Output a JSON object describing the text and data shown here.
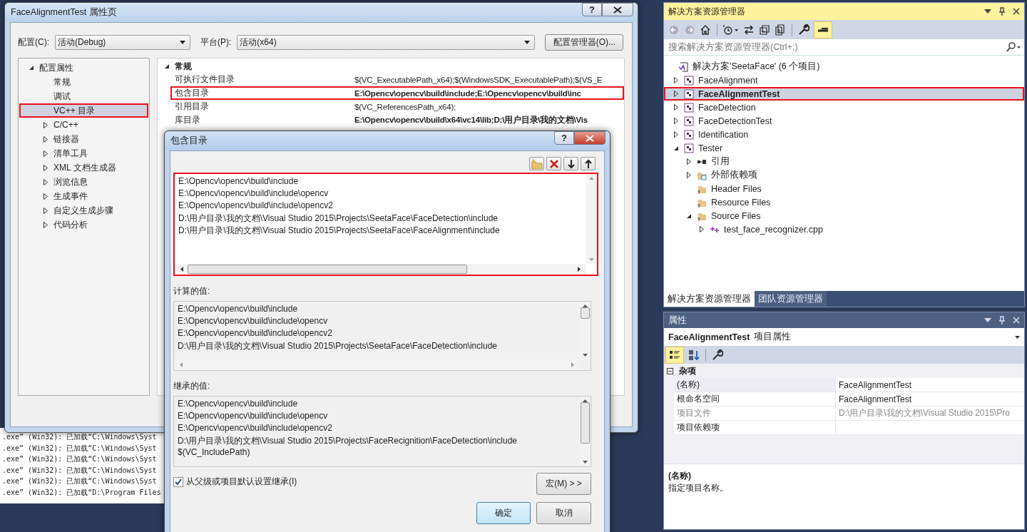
{
  "property_window": {
    "title": "FaceAlignmentTest 属性页",
    "help": "?",
    "configuration": {
      "label": "配置(C):",
      "value": "活动(Debug)"
    },
    "platform": {
      "label": "平台(P):",
      "value": "活动(x64)"
    },
    "config_manager_button": "配置管理器(O)...",
    "tree": [
      {
        "label": "配置属性",
        "expanded": true,
        "selected": false,
        "highlighted": false,
        "children": [
          {
            "label": "常规",
            "selected": false,
            "highlighted": false
          },
          {
            "label": "调试",
            "selected": false,
            "highlighted": false
          },
          {
            "label": "VC++ 目录",
            "selected": true,
            "highlighted": true
          },
          {
            "label": "C/C++",
            "selected": false,
            "highlighted": false,
            "expanded": false
          },
          {
            "label": "链接器",
            "selected": false,
            "highlighted": false,
            "expanded": false
          },
          {
            "label": "清单工具",
            "selected": false,
            "highlighted": false,
            "expanded": false
          },
          {
            "label": "XML 文档生成器",
            "selected": false,
            "highlighted": false,
            "expanded": false
          },
          {
            "label": "浏览信息",
            "selected": false,
            "highlighted": false,
            "expanded": false
          },
          {
            "label": "生成事件",
            "selected": false,
            "highlighted": false,
            "expanded": false
          },
          {
            "label": "自定义生成步骤",
            "selected": false,
            "highlighted": false,
            "expanded": false
          },
          {
            "label": "代码分析",
            "selected": false,
            "highlighted": false,
            "expanded": false
          }
        ]
      }
    ],
    "grid": {
      "category": "常规",
      "expanded": true,
      "rows": [
        {
          "name": "可执行文件目录",
          "value": "$(VC_ExecutablePath_x64);$(WindowsSDK_ExecutablePath);$(VS_E",
          "bold": false,
          "highlighted": false
        },
        {
          "name": "包含目录",
          "value": "E:\\Opencv\\opencv\\build\\include;E:\\Opencv\\opencv\\build\\inc",
          "bold": true,
          "highlighted": true
        },
        {
          "name": "引用目录",
          "value": "$(VC_ReferencesPath_x64);",
          "bold": false,
          "highlighted": false
        },
        {
          "name": "库目录",
          "value": "E:\\Opencv\\opencv\\build\\x64\\vc14\\lib;D:\\用户目录\\我的文档\\Vis",
          "bold": true,
          "highlighted": false
        }
      ]
    }
  },
  "include_dialog": {
    "title": "包含目录",
    "help": "?",
    "list_highlighted": true,
    "entries": [
      "E:\\Opencv\\opencv\\build\\include",
      "E:\\Opencv\\opencv\\build\\include\\opencv",
      "E:\\Opencv\\opencv\\build\\include\\opencv2",
      "D:\\用户目录\\我的文档\\Visual Studio 2015\\Projects\\SeetaFace\\FaceDetection\\include",
      "D:\\用户目录\\我的文档\\Visual Studio 2015\\Projects\\SeetaFace\\FaceAlignment\\include"
    ],
    "computed_label": "计算的值:",
    "computed": [
      "E:\\Opencv\\opencv\\build\\include",
      "E:\\Opencv\\opencv\\build\\include\\opencv",
      "E:\\Opencv\\opencv\\build\\include\\opencv2",
      "D:\\用户目录\\我的文档\\Visual Studio 2015\\Projects\\SeetaFace\\FaceDetection\\include"
    ],
    "inherited_label": "继承的值:",
    "inherited": [
      "E:\\Opencv\\opencv\\build\\include",
      "E:\\Opencv\\opencv\\build\\include\\opencv",
      "E:\\Opencv\\opencv\\build\\include\\opencv2",
      "D:\\用户目录\\我的文档\\Visual Studio 2015\\Projects\\FaceRecignition\\FaceDetection\\include",
      "$(VC_IncludePath)"
    ],
    "inherit_checkbox": {
      "label": "从父级或项目默认设置继承(I)",
      "checked": true
    },
    "macros_button": "宏(M) > >",
    "ok_button": "确定",
    "cancel_button": "取消"
  },
  "output_lines": [
    ".exe” (Win32): 已加载“C:\\Windows\\Syst",
    ".exe” (Win32): 已加载“C:\\Windows\\Syst",
    ".exe” (Win32): 已加载“C:\\Windows\\Syst",
    ".exe” (Win32): 已加载“C:\\Windows\\Syst",
    ".exe” (Win32): 已加载“C:\\Windows\\Syst",
    ".exe” (Win32): 已加载“D:\\Program Files"
  ],
  "solution_explorer": {
    "title": "解决方案资源管理器",
    "preview_on": true,
    "search_placeholder": "搜索解决方案资源管理器(Ctrl+;)",
    "tree": [
      {
        "kind": "solution",
        "label": "解决方案'SeetaFace' (6 个项目)",
        "selected": false,
        "highlighted": false,
        "children": [
          {
            "kind": "project",
            "label": "FaceAlignment",
            "expanded": false,
            "selected": false,
            "highlighted": false
          },
          {
            "kind": "project",
            "label": "FaceAlignmentTest",
            "expanded": false,
            "selected": true,
            "highlighted": true
          },
          {
            "kind": "project",
            "label": "FaceDetection",
            "expanded": false,
            "selected": false,
            "highlighted": false
          },
          {
            "kind": "project",
            "label": "FaceDetectionTest",
            "expanded": false,
            "selected": false,
            "highlighted": false
          },
          {
            "kind": "project",
            "label": "Identification",
            "expanded": false,
            "selected": false,
            "highlighted": false
          },
          {
            "kind": "project",
            "label": "Tester",
            "expanded": true,
            "selected": false,
            "highlighted": false,
            "children": [
              {
                "kind": "references",
                "label": "引用",
                "expanded": false,
                "selected": false,
                "highlighted": false
              },
              {
                "kind": "external",
                "label": "外部依赖项",
                "expanded": false,
                "selected": false,
                "highlighted": false
              },
              {
                "kind": "filter",
                "label": "Header Files",
                "selected": false,
                "highlighted": false
              },
              {
                "kind": "filter",
                "label": "Resource Files",
                "selected": false,
                "highlighted": false
              },
              {
                "kind": "filter",
                "label": "Source Files",
                "expanded": true,
                "selected": false,
                "highlighted": false,
                "children": [
                  {
                    "kind": "cpp",
                    "label": "test_face_recognizer.cpp",
                    "expanded": false,
                    "selected": false,
                    "highlighted": false
                  }
                ]
              }
            ]
          }
        ]
      }
    ],
    "tabs": [
      {
        "label": "解决方案资源管理器",
        "selected": true
      },
      {
        "label": "团队资源管理器",
        "selected": false
      }
    ]
  },
  "properties": {
    "title": "属性",
    "object": {
      "name": "FaceAlignmentTest",
      "type": "项目属性"
    },
    "categorized_on": true,
    "category": "杂项",
    "expanded": true,
    "rows": [
      {
        "name": "(名称)",
        "value": "FaceAlignmentTest",
        "selected": true,
        "disabled": false
      },
      {
        "name": "根命名空间",
        "value": "FaceAlignmentTest",
        "selected": false,
        "disabled": false
      },
      {
        "name": "项目文件",
        "value": "D:\\用户目录\\我的文档\\Visual Studio 2015\\Pro",
        "selected": false,
        "disabled": true
      },
      {
        "name": "项目依赖项",
        "selected": false,
        "disabled": false
      }
    ],
    "description": {
      "title": "(名称)",
      "text": "指定项目名称。"
    }
  }
}
